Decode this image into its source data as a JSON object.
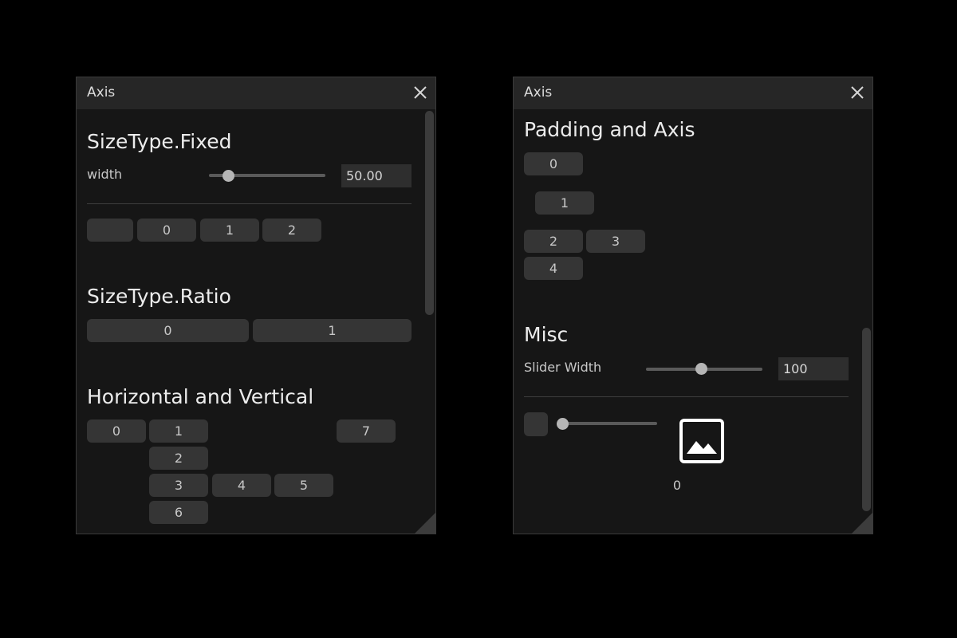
{
  "colors": {
    "background": "#000000",
    "window_bg": "#161616",
    "titlebar_bg": "#262626",
    "button_bg": "#353535",
    "text": "#c8c8c8"
  },
  "left_window": {
    "title": "Axis",
    "fixed": {
      "heading": "SizeType.Fixed",
      "width_label": "width",
      "width_value": "50.00",
      "width_slider_fraction": 0.17,
      "buttons": [
        "",
        "0",
        "1",
        "2"
      ]
    },
    "ratio": {
      "heading": "SizeType.Ratio",
      "buttons": [
        "0",
        "1"
      ]
    },
    "hv": {
      "heading": "Horizontal and Vertical",
      "buttons": [
        "0",
        "1",
        "2",
        "3",
        "4",
        "5",
        "6",
        "7"
      ]
    }
  },
  "right_window": {
    "title": "Axis",
    "padding": {
      "heading": "Padding and Axis",
      "buttons": [
        "0",
        "1",
        "2",
        "3",
        "4"
      ]
    },
    "misc": {
      "heading": "Misc",
      "slider_label": "Slider Width",
      "slider_value": "100",
      "slider_fraction": 0.47,
      "image_caption": "0",
      "image_icon": "image-icon"
    }
  }
}
